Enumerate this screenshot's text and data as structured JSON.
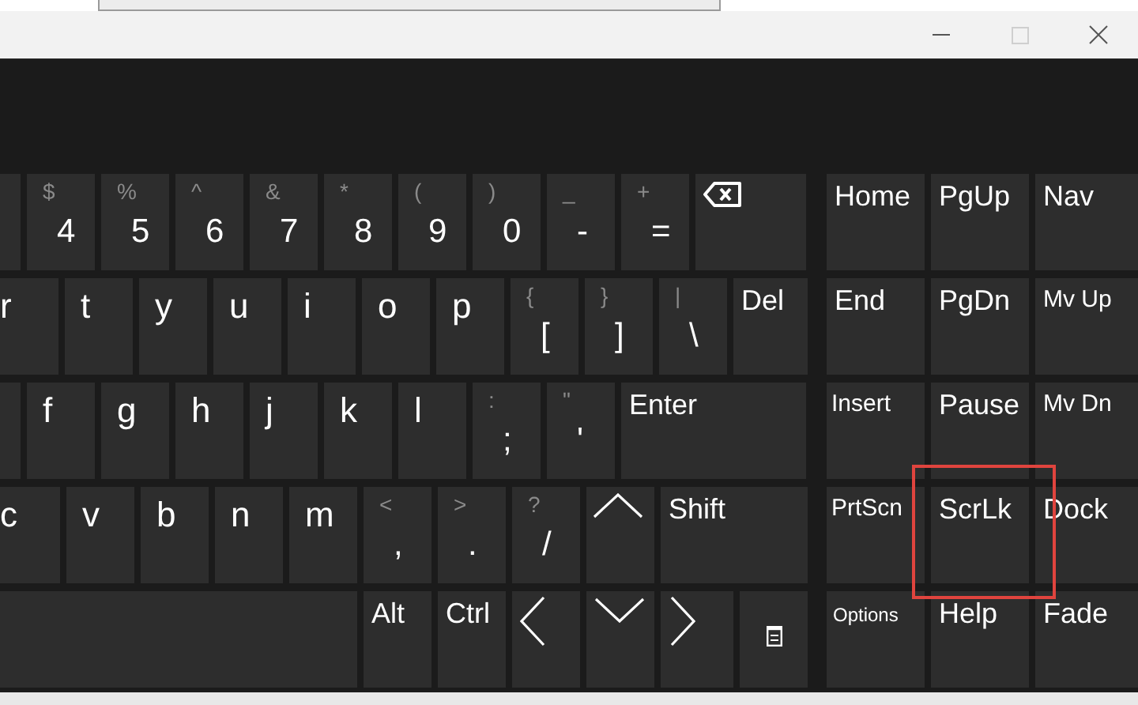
{
  "title_bar": {
    "buttons": [
      {
        "kind": "minimize",
        "disabled": false
      },
      {
        "kind": "maximize",
        "disabled": true
      },
      {
        "kind": "close",
        "disabled": false
      }
    ]
  },
  "main_keys": [
    [
      {
        "kind": "blank"
      },
      {
        "kind": "symbol",
        "shift": "$",
        "main": "4"
      },
      {
        "kind": "symbol",
        "shift": "%",
        "main": "5"
      },
      {
        "kind": "symbol",
        "shift": "^",
        "main": "6"
      },
      {
        "kind": "symbol",
        "shift": "&",
        "main": "7"
      },
      {
        "kind": "symbol",
        "shift": "*",
        "main": "8"
      },
      {
        "kind": "symbol",
        "shift": "(",
        "main": "9"
      },
      {
        "kind": "symbol",
        "shift": ")",
        "main": "0"
      },
      {
        "kind": "symbol",
        "shift": "_",
        "main": "-"
      },
      {
        "kind": "symbol",
        "shift": "+",
        "main": "="
      },
      {
        "kind": "backspace"
      }
    ],
    [
      {
        "kind": "letter",
        "main": "r"
      },
      {
        "kind": "letter",
        "main": "t"
      },
      {
        "kind": "letter",
        "main": "y"
      },
      {
        "kind": "letter",
        "main": "u"
      },
      {
        "kind": "letter",
        "main": "i"
      },
      {
        "kind": "letter",
        "main": "o"
      },
      {
        "kind": "letter",
        "main": "p"
      },
      {
        "kind": "symbol",
        "shift": "{",
        "main": "["
      },
      {
        "kind": "symbol",
        "shift": "}",
        "main": "]"
      },
      {
        "kind": "symbol",
        "shift": "|",
        "main": "\\"
      },
      {
        "kind": "label",
        "label": "Del"
      }
    ],
    [
      {
        "kind": "blank"
      },
      {
        "kind": "letter",
        "main": "f"
      },
      {
        "kind": "letter",
        "main": "g"
      },
      {
        "kind": "letter",
        "main": "h"
      },
      {
        "kind": "letter",
        "main": "j"
      },
      {
        "kind": "letter",
        "main": "k"
      },
      {
        "kind": "letter",
        "main": "l"
      },
      {
        "kind": "symbol",
        "shift": ":",
        "main": ";"
      },
      {
        "kind": "symbol",
        "shift": "\"",
        "main": "'"
      },
      {
        "kind": "label",
        "label": "Enter"
      }
    ],
    [
      {
        "kind": "letter",
        "main": "c"
      },
      {
        "kind": "letter",
        "main": "v"
      },
      {
        "kind": "letter",
        "main": "b"
      },
      {
        "kind": "letter",
        "main": "n"
      },
      {
        "kind": "letter",
        "main": "m"
      },
      {
        "kind": "symbol",
        "shift": "<",
        "main": ","
      },
      {
        "kind": "symbol",
        "shift": ">",
        "main": "."
      },
      {
        "kind": "symbol",
        "shift": "?",
        "main": "/"
      },
      {
        "kind": "up"
      },
      {
        "kind": "label",
        "label": "Shift"
      }
    ],
    [
      {
        "kind": "blank"
      },
      {
        "kind": "label",
        "label": "Alt"
      },
      {
        "kind": "label",
        "label": "Ctrl"
      },
      {
        "kind": "left"
      },
      {
        "kind": "down"
      },
      {
        "kind": "right"
      },
      {
        "kind": "menu"
      }
    ]
  ],
  "nav_keys": [
    [
      {
        "kind": "label",
        "label": "Home",
        "highlighted": false
      },
      {
        "kind": "label",
        "label": "PgUp",
        "highlighted": false
      },
      {
        "kind": "label",
        "label": "Nav",
        "highlighted": false
      }
    ],
    [
      {
        "kind": "label",
        "label": "End",
        "highlighted": false
      },
      {
        "kind": "label",
        "label": "PgDn",
        "highlighted": false
      },
      {
        "kind": "medium-label",
        "label": "Mv Up",
        "highlighted": false
      }
    ],
    [
      {
        "kind": "label",
        "label": "Insert",
        "highlighted": false
      },
      {
        "kind": "label",
        "label": "Pause",
        "highlighted": false
      },
      {
        "kind": "medium-label",
        "label": "Mv Dn",
        "highlighted": false
      }
    ],
    [
      {
        "kind": "label",
        "label": "PrtScn",
        "highlighted": false
      },
      {
        "kind": "label",
        "label": "ScrLk",
        "highlighted": true
      },
      {
        "kind": "label",
        "label": "Dock",
        "highlighted": false
      }
    ],
    [
      {
        "kind": "small-label",
        "label": "Options",
        "highlighted": false
      },
      {
        "kind": "label",
        "label": "Help",
        "highlighted": false
      },
      {
        "kind": "label",
        "label": "Fade",
        "highlighted": false
      }
    ]
  ]
}
